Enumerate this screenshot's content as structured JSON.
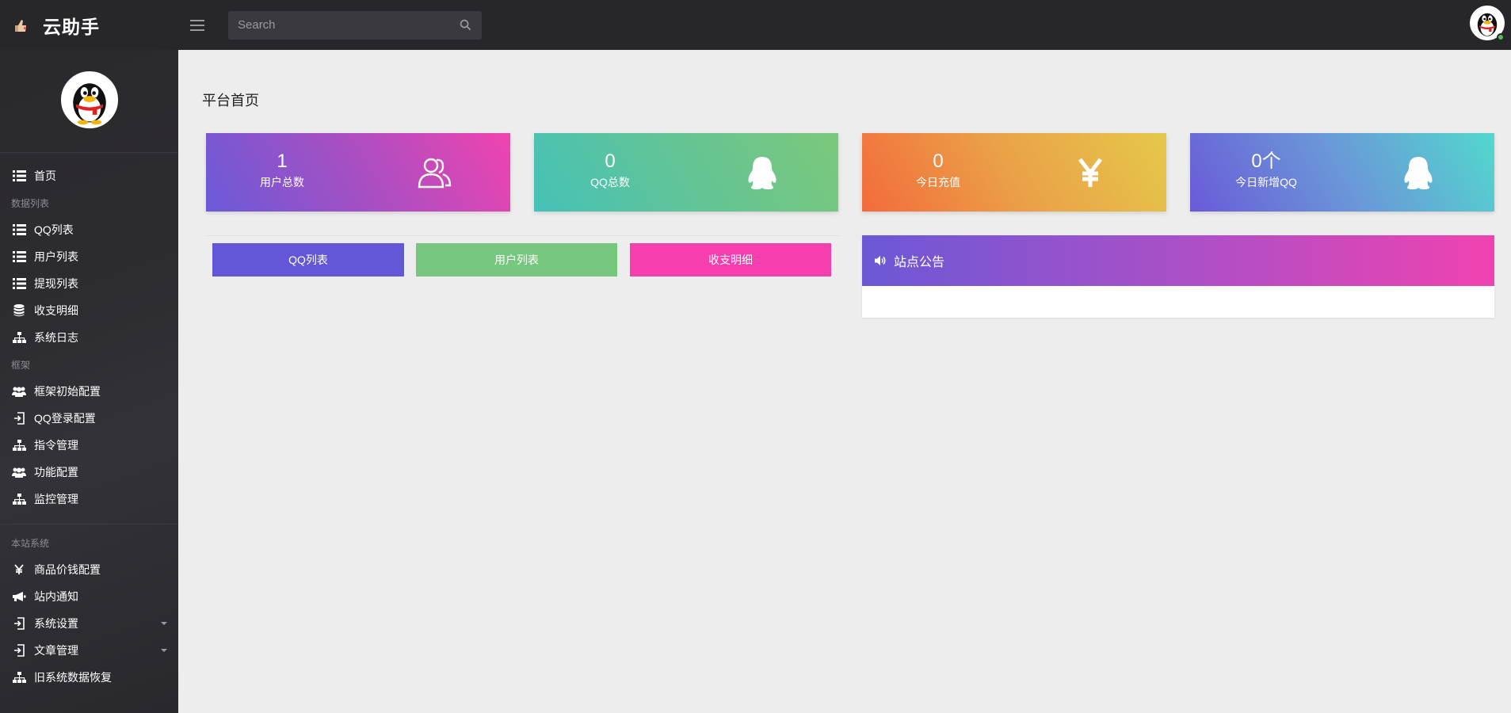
{
  "brand": {
    "title": "云助手"
  },
  "search": {
    "placeholder": "Search"
  },
  "sidebar": {
    "home": "首页",
    "section_data": "数据列表",
    "data_items": [
      "QQ列表",
      "用户列表",
      "提现列表",
      "收支明细",
      "系统日志"
    ],
    "section_frame": "框架",
    "frame_items": [
      "框架初始配置",
      "QQ登录配置",
      "指令管理",
      "功能配置",
      "监控管理"
    ],
    "section_site": "本站系统",
    "site_items": [
      "商品价钱配置",
      "站内通知",
      "系统设置",
      "文章管理",
      "旧系统数据恢复"
    ]
  },
  "page": {
    "title": "平台首页"
  },
  "stats": [
    {
      "value": "1",
      "label": "用户总数",
      "icon": "users-icon"
    },
    {
      "value": "0",
      "label": "QQ总数",
      "icon": "qq-icon"
    },
    {
      "value": "0",
      "label": "今日充值",
      "icon": "yen-icon"
    },
    {
      "value": "0个",
      "label": "今日新增QQ",
      "icon": "qq-icon"
    }
  ],
  "quick_buttons": [
    "QQ列表",
    "用户列表",
    "收支明细"
  ],
  "notice": {
    "title": "站点公告"
  },
  "colors": {
    "topbar": "#27262b",
    "sidebar": "#2d2c31",
    "background": "#ededed",
    "btn_purple": "#6357d8",
    "btn_green": "#77c77e",
    "btn_pink": "#f53fae"
  }
}
